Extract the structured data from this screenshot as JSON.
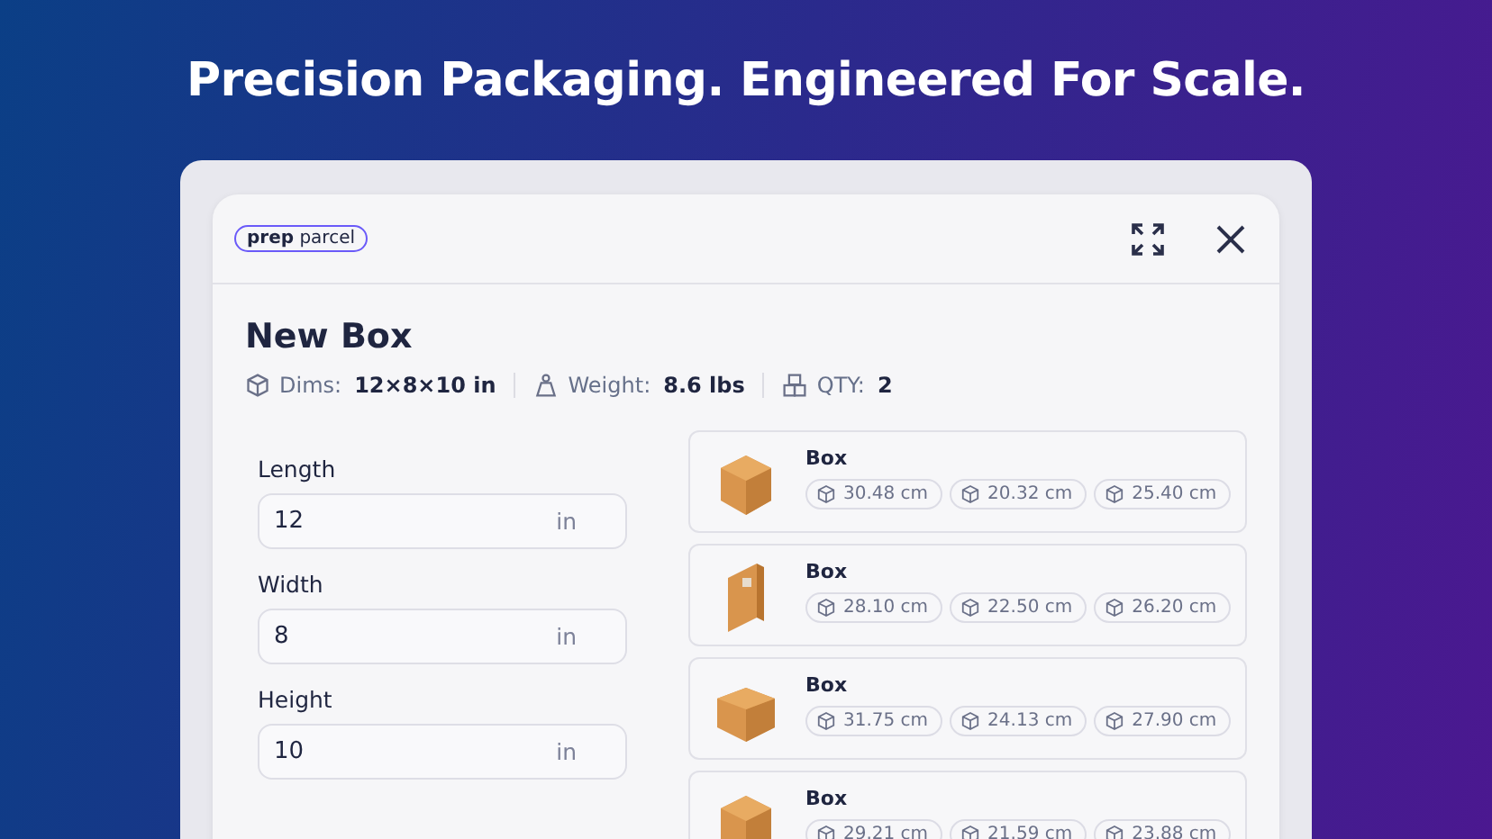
{
  "headline": "Precision Packaging. Engineered For Scale.",
  "logo": "**prep** parcel",
  "title": "New Box",
  "meta": [
    {
      "kind": "dims",
      "label": "Dims:",
      "value": "12×8×10 in"
    },
    {
      "kind": "weight",
      "label": "Weight:",
      "value": "8.6 lbs"
    },
    {
      "kind": "qty",
      "label": "QTY:",
      "value": "2"
    }
  ],
  "fields": [
    {
      "label": "Length",
      "value": "12",
      "unit": "in"
    },
    {
      "label": "Width",
      "value": "8",
      "unit": "in"
    },
    {
      "label": "Height",
      "value": "10",
      "unit": "in"
    }
  ],
  "boxes": [
    {
      "kind": "cube",
      "name": "Box",
      "dims": [
        "30.48 cm",
        "20.32 cm",
        "25.40 cm"
      ]
    },
    {
      "kind": "tall",
      "name": "Box",
      "dims": [
        "28.10 cm",
        "22.50 cm",
        "26.20 cm"
      ]
    },
    {
      "kind": "wide",
      "name": "Box",
      "dims": [
        "31.75 cm",
        "24.13 cm",
        "27.90 cm"
      ]
    },
    {
      "kind": "cube",
      "name": "Box",
      "dims": [
        "29.21 cm",
        "21.59 cm",
        "23.88 cm"
      ]
    }
  ]
}
